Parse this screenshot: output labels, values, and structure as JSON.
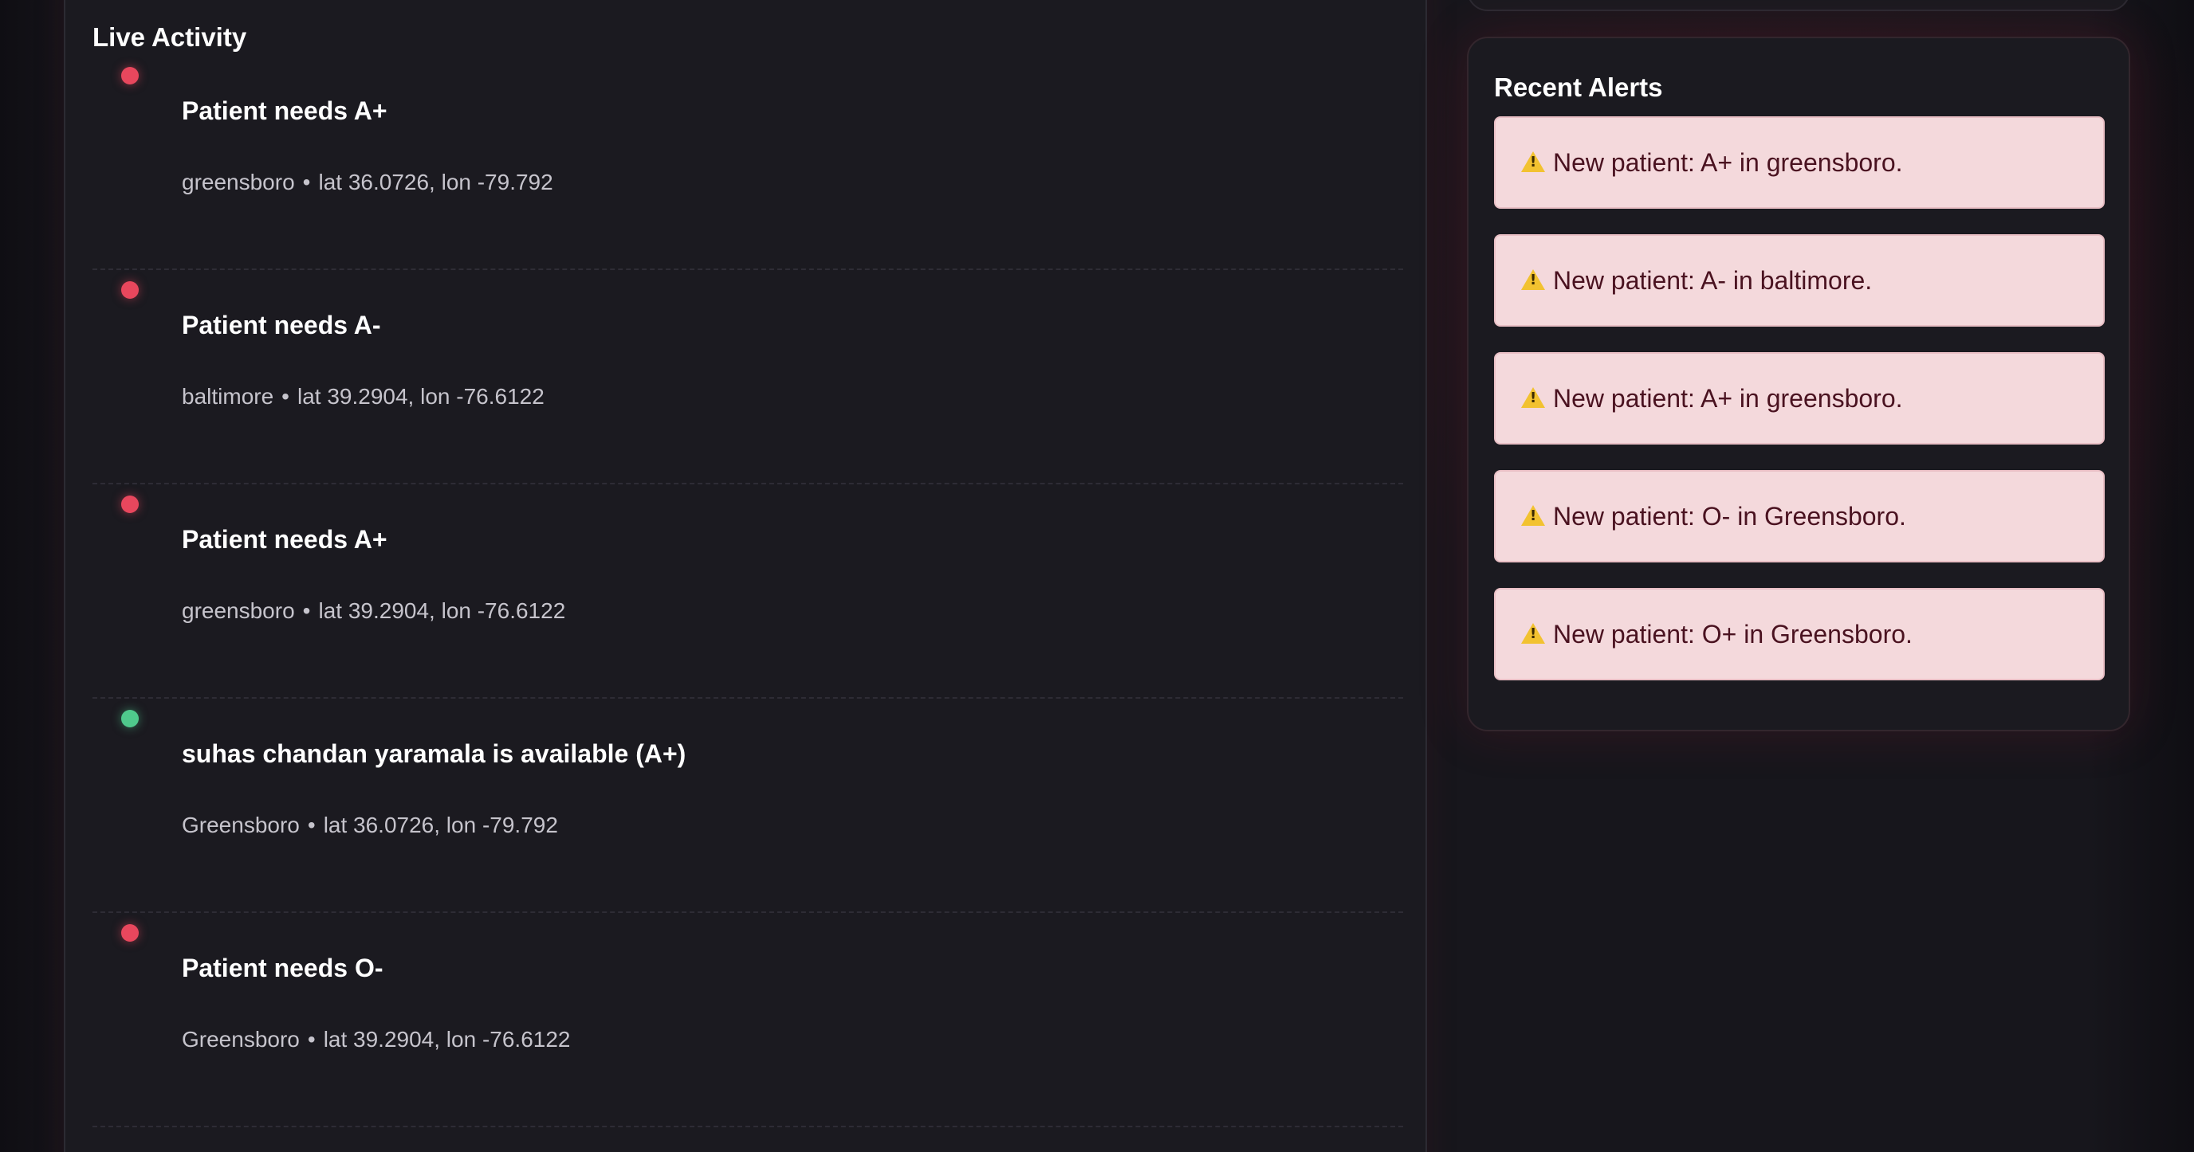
{
  "activity": {
    "title": "Live Activity",
    "separator": "•",
    "items": [
      {
        "status": "red",
        "title": "Patient needs A+",
        "city": "greensboro",
        "coords": "lat 36.0726, lon -79.792"
      },
      {
        "status": "red",
        "title": "Patient needs A-",
        "city": "baltimore",
        "coords": "lat 39.2904, lon -76.6122"
      },
      {
        "status": "red",
        "title": "Patient needs A+",
        "city": "greensboro",
        "coords": "lat 39.2904, lon -76.6122"
      },
      {
        "status": "green",
        "title": "suhas chandan yaramala is available (A+)",
        "city": "Greensboro",
        "coords": "lat 36.0726, lon -79.792"
      },
      {
        "status": "red",
        "title": "Patient needs O-",
        "city": "Greensboro",
        "coords": "lat 39.2904, lon -76.6122"
      }
    ]
  },
  "alerts": {
    "title": "Recent Alerts",
    "icon": "warning-icon",
    "items": [
      {
        "text": "New patient: A+ in greensboro."
      },
      {
        "text": "New patient: A- in baltimore."
      },
      {
        "text": "New patient: A+ in greensboro."
      },
      {
        "text": "New patient: O- in Greensboro."
      },
      {
        "text": "New patient: O+ in Greensboro."
      }
    ]
  },
  "colors": {
    "background": "#17161c",
    "panel": "#1b1a20",
    "status_red": "#e8475d",
    "status_green": "#4fc98c",
    "alert_background": "#f4d9dc",
    "alert_text": "#4a1220"
  }
}
